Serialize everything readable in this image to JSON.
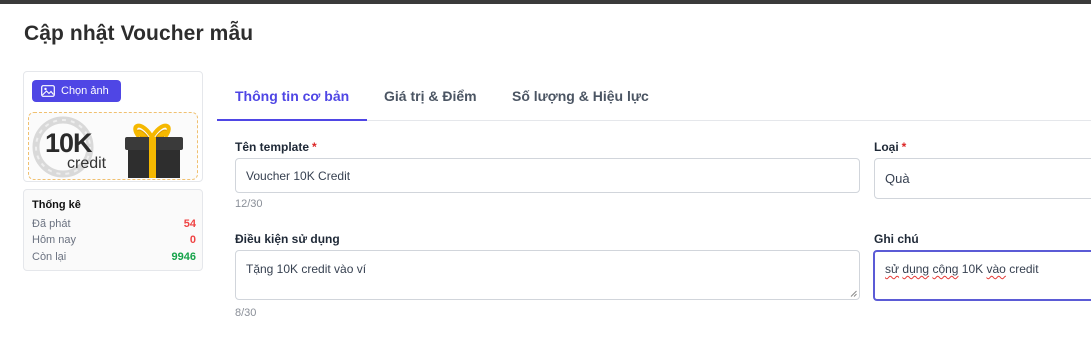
{
  "modal": {
    "title": "Cập nhật Voucher mẫu"
  },
  "image_panel": {
    "pick_button": "Chọn ảnh",
    "voucher_text_big": "10K",
    "voucher_text_small": "credit"
  },
  "stats": {
    "title": "Thống kê",
    "rows": [
      {
        "label": "Đã phát",
        "value": "54",
        "color": "#ef4444"
      },
      {
        "label": "Hôm nay",
        "value": "0",
        "color": "#ef4444"
      },
      {
        "label": "Còn lại",
        "value": "9946",
        "color": "#16a34a"
      }
    ]
  },
  "tabs": [
    {
      "label": "Thông tin cơ bản",
      "active": true
    },
    {
      "label": "Giá trị & Điểm",
      "active": false
    },
    {
      "label": "Số lượng & Hiệu lực",
      "active": false
    }
  ],
  "form": {
    "template_name": {
      "label": "Tên template",
      "required_mark": "*",
      "value": "Voucher 10K Credit",
      "counter": "12/30"
    },
    "type": {
      "label": "Loại",
      "required_mark": "*",
      "value": "Quà"
    },
    "condition": {
      "label": "Điều kiện sử dụng",
      "value": "Tặng 10K credit vào ví",
      "counter": "8/30"
    },
    "note": {
      "label": "Ghi chú",
      "value_parts": [
        "sử",
        " ",
        "dụng",
        " ",
        "cộng",
        " 10K ",
        "vào",
        " credit"
      ]
    }
  },
  "colors": {
    "accent": "#4f46e5",
    "danger": "#ef4444",
    "success": "#16a34a"
  }
}
